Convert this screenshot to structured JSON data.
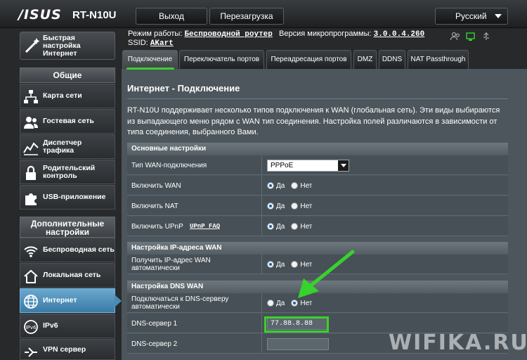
{
  "header": {
    "brand": "/ISUS",
    "model": "RT-N10U",
    "logout_label": "Выход",
    "reboot_label": "Перезагрузка",
    "language": "Русский"
  },
  "status": {
    "mode_label": "Режим работы:",
    "mode_value": "Беспроводной роутер",
    "firmware_label": "Версия микропрограммы:",
    "firmware_value": "3.0.0.4.260",
    "ssid_label": "SSID:",
    "ssid_value": "AKart"
  },
  "sidebar": {
    "quick_setup": "Быстрая настройка Интернет",
    "general_header": "Общие",
    "advanced_header": "Дополнительные настройки",
    "items": [
      {
        "label": "Карта сети"
      },
      {
        "label": "Гостевая сеть"
      },
      {
        "label": "Диспетчер трафика"
      },
      {
        "label": "Родительский контроль"
      },
      {
        "label": "USB-приложение"
      },
      {
        "label": "Беспроводная сеть"
      },
      {
        "label": "Локальная сеть"
      },
      {
        "label": "Интернет"
      },
      {
        "label": "IPv6"
      },
      {
        "label": "VPN сервер"
      }
    ]
  },
  "tabs": [
    {
      "label": "Подключение"
    },
    {
      "label": "Переключатель портов"
    },
    {
      "label": "Переадресация портов"
    },
    {
      "label": "DMZ"
    },
    {
      "label": "DDNS"
    },
    {
      "label": "NAT Passthrough"
    }
  ],
  "page": {
    "title": "Интернет - Подключение",
    "description": "RT-N10U поддерживает несколько типов подключения к WAN (глобальная сеть). Эти виды выбираются из выпадающего меню рядом с WAN тип соединения. Настройка полей различаются в зависимости от типа соединения, выбранного Вами."
  },
  "sections": {
    "basic": {
      "title": "Основные настройки",
      "wan_type_label": "Тип WAN-подключения",
      "wan_type_value": "PPPoE",
      "enable_wan_label": "Включить WAN",
      "enable_nat_label": "Включить NAT",
      "enable_upnp_label": "Включить UPnP",
      "upnp_faq": "UPnP FAQ"
    },
    "wan_ip": {
      "title": "Настройка IP-адреса WAN",
      "auto_ip_label": "Получить IP-адрес WAN автоматически"
    },
    "dns": {
      "title": "Настройка DNS WAN",
      "auto_dns_label": "Подключаться к DNS-серверу автоматически",
      "dns1_label": "DNS-сервер 1",
      "dns1_value": "77.88.8.88",
      "dns2_label": "DNS-сервер 2",
      "dns2_value": ""
    }
  },
  "radio": {
    "yes": "Да",
    "no": "Нет"
  },
  "watermark": "WIFIKA.RU"
}
